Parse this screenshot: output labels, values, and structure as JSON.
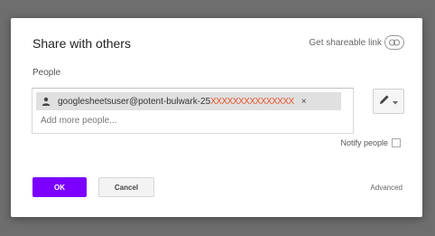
{
  "dialog": {
    "title": "Share with others",
    "get_link_label": "Get shareable link",
    "people_label": "People",
    "chip": {
      "email_visible": "googlesheetsuser@potent-bulwark-25",
      "email_redacted": "XXXXXXXXXXXXXXX",
      "close_glyph": "×"
    },
    "add_more_placeholder": "Add more people...",
    "notify_label": "Notify people",
    "notify_checked": false,
    "ok_label": "OK",
    "cancel_label": "Cancel",
    "advanced_label": "Advanced",
    "permission_icon": "pencil-icon",
    "colors": {
      "accent": "#7b00ff",
      "chip_bg": "#e0e0e0",
      "redaction": "#e8532a"
    }
  }
}
